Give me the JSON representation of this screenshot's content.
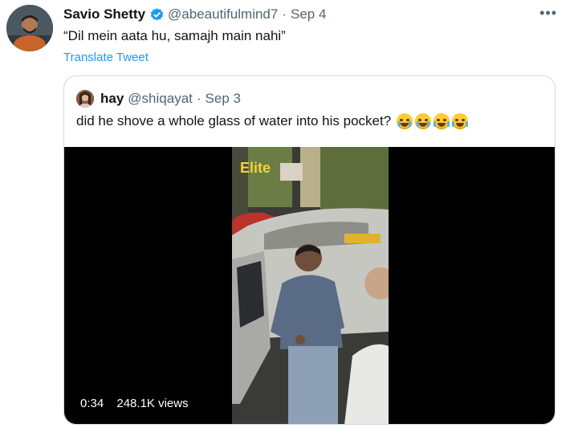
{
  "tweet": {
    "author_name": "Savio Shetty",
    "handle": "@abeautifulmind7",
    "separator": "·",
    "date": "Sep 4",
    "text": "“Dil mein aata hu, samajh main nahi”",
    "translate_label": "Translate Tweet",
    "more_label": "•••",
    "verified": true
  },
  "quoted_tweet": {
    "author_name": "hay",
    "handle": "@shiqayat",
    "separator": "·",
    "date": "Sep 3",
    "text": "did he shove a whole glass of water into his pocket?",
    "emojis": [
      "loudly-crying-face",
      "loudly-crying-face",
      "face-with-tears-of-joy",
      "face-with-tears-of-joy"
    ]
  },
  "video": {
    "duration": "0:34",
    "views": "248.1K views",
    "watermark": "Elite"
  },
  "colors": {
    "accent": "#1d9bf0",
    "muted": "#536471",
    "border": "#cfd9de"
  }
}
